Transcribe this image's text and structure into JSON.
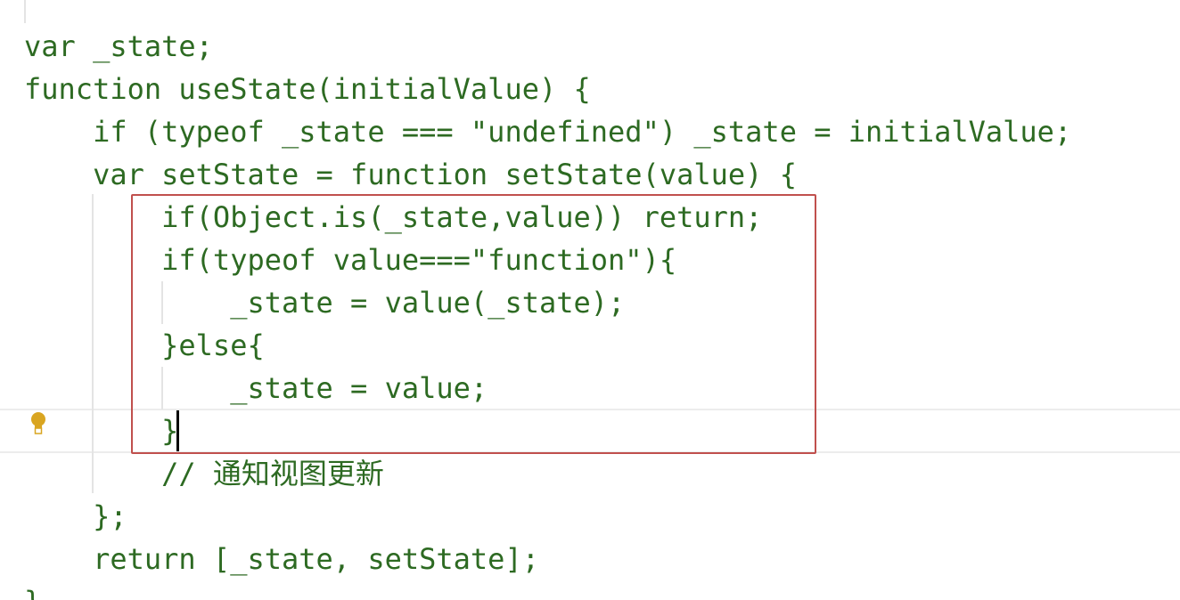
{
  "editor": {
    "lines": [
      {
        "text": "var _state;"
      },
      {
        "text": "function useState(initialValue) {"
      },
      {
        "text": "    if (typeof _state === \"undefined\") _state = initialValue;"
      },
      {
        "text": "    var setState = function setState(value) {"
      },
      {
        "text": "        if(Object.is(_state,value)) return;"
      },
      {
        "text": "        if(typeof value===\"function\"){"
      },
      {
        "text": "            _state = value(_state);"
      },
      {
        "text": "        }else{"
      },
      {
        "text": "            _state = value;"
      },
      {
        "text": "        }"
      },
      {
        "text": "        // 通知视图更新"
      },
      {
        "text": "    };"
      },
      {
        "text": "    return [_state, setState];"
      },
      {
        "text": "}"
      }
    ],
    "colors": {
      "code_text": "#2d6a22",
      "highlight_box": "#c0504d",
      "indent_guide": "#e4e4e4",
      "current_line_border": "#ececec",
      "caret": "#000000",
      "bulb": "#d9a521"
    },
    "icons": {
      "gutter_icon": "lightbulb-icon"
    }
  }
}
